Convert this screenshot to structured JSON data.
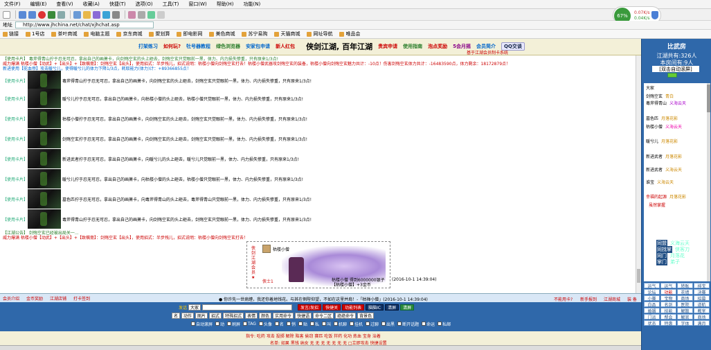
{
  "browser": {
    "menu": [
      "文件(F)",
      "编辑(E)",
      "查看(V)",
      "收藏(A)",
      "快捷(T)",
      "选项(O)",
      "工具(T)",
      "窗口(W)",
      "帮助(H)",
      "功能(N)"
    ],
    "address_label": "地址",
    "address_url": "http://www.jhchina.net/chat/xjhchat.asp",
    "bookmarks": [
      "链接",
      "1号店",
      "茶叶商城",
      "电脑主题",
      "京东商城",
      "聚划算",
      "即电影网",
      "美色商城",
      "苏宁易购",
      "天猫商城",
      "网址导航",
      "唯品会"
    ],
    "net_percent": "67%",
    "net_up": "0.07K/s",
    "net_down": "0.04K/s"
  },
  "topbar": {
    "links": [
      "打架练习",
      "如何玩?",
      "牡号器教程",
      "绿色浏览器",
      "安家包申请",
      "新人红包"
    ],
    "site_title": "侠剑江湖, 百年江湖",
    "links_right": [
      "贵宾申请",
      "使用指南",
      "泡点奖励",
      "5会月摇",
      "会员简介"
    ],
    "qq_label": "QQ交谈",
    "subtitle": "基于江湖会员制卡系统"
  },
  "chat": {
    "header_lines": [
      "【使用卡片】 毒斧得青山拧于忍无可忍，拿出自己的画萧卡，向剑殇空玄的头上砸去，剑殇空玄只觉眼前一黑，体力、内力损失惨重，只有原来1/3点!",
      "威力爆满 枯楼小僧【动武】+【出头】+【致嘱斋】：剑殇空玄【出头】，使用招式：半步残儿，招式说明：枯楼小僧向剑殇空玄打去！枯楼小僧武器攻剑殇空玄的装备，枯楼小僧向剑殇空玄魅力共计：-10点！伤害剑殇空玄体力共计：-16483590点，体力剩余：18172879点！",
      "新进使用【驼血帝】攻击暖兮儿，使得暖兮儿的体力下降1/3点，耗取能力(体力)计：+89366855点！"
    ],
    "entries": [
      {
        "tag": "【使用卡片】",
        "msg": "毒斧得青山拧于忍无可忍，拿出自己的画萧卡，向剑殇空玄的头上砸去，剑殇空玄只觉眼前一黑，体力、内力损失惨重，只有原来1/3点!"
      },
      {
        "tag": "【使用卡片】",
        "msg": "暖兮儿拧于忍无可忍，拿出自己的画萧卡，向枯楼小僧的头上砸去，枯楼小僧只觉眼前一黑，体力、内力损失惨重，只有原来1/3点!"
      },
      {
        "tag": "【使用卡片】",
        "msg": "枯楼小僧拧于忍无可忍，拿出自己的画萧卡，向剑殇空玄的头上砸去，剑殇空玄只觉眼前一黑，体力、内力损失惨重，只有原来1/3点!"
      },
      {
        "tag": "【使用卡片】",
        "msg": "剑殇空玄拧于忍无可忍，拿出自己的画萧卡，向剑殇空玄的头上砸去，剑殇空玄只觉眼前一黑，体力、内力损失惨重，只有原来1/3点!"
      },
      {
        "tag": "【使用卡片】",
        "msg": "新进武者拧于忍无可忍，拿出自己的画萧卡，向暖兮儿的头上砸去，暖兮儿只觉眼前一黑，体力、内力损失惨重，只有原来1/3点!"
      },
      {
        "tag": "【使用卡片】",
        "msg": "暖兮儿拧于忍无可忍，拿出自己的画萧卡，向枯楼小僧的头上砸去，枯楼小僧只觉眼前一黑，体力、内力损失惨重，只有原来1/3点!"
      },
      {
        "tag": "【使用卡片】",
        "msg": "墓色匹拧于忍无可忍，拿出自己的画萧卡，向毒斧得青山的头上砸去，毒斧得青山只觉眼前一黑，体力、内力损失惨重，只有原来1/3点!"
      },
      {
        "tag": "【使用卡片】",
        "msg": "毒斧得青山拧于忍无可忍，拿出自己的画萧卡，向剑殇空玄的头上砸去，剑殇空玄只觉眼前一黑，体力、内力损失惨重，只有原来1/3点!"
      }
    ],
    "footer_lines": [
      "【江湖公告】 剑殇空玄已经被出局关一...",
      "威力爆满 枯楼小僧【动武】+【出头】+【致嘱斋】：剑殇空玄【出头】，使用招式：半步残儿，招式说明：枯楼小僧向剑殇空玄打去！"
    ],
    "battle": {
      "vertical": "侠剑江湖会员★",
      "name": "枯楼小僧",
      "result1": "枯楼小僧 得到6000000银子",
      "result2": "【枯楼小僧】+3金币",
      "gear": "侠士1",
      "date": "(2016-10-1 14:39:04)"
    }
  },
  "sidebar": {
    "title": "比武房",
    "total": "江湖共有:326人",
    "room": "本房间有:9人",
    "select": "[双击自动滚屏]",
    "everyone": "大家",
    "users": [
      {
        "name": "剑殇空玄",
        "title": "青白"
      },
      {
        "name": "毒斧得青山",
        "title": "义海云天"
      },
      {
        "name": "墓色匹",
        "title": "月落花影"
      },
      {
        "name": "枯楼小僧",
        "title": "义海云天"
      },
      {
        "name": "暖兮儿",
        "title": "月落花影"
      },
      {
        "name": "新进武者",
        "title": "月落花影"
      },
      {
        "name": "新进武者",
        "title": "义海云天"
      },
      {
        "name": "谁宝",
        "title": "义海云天"
      },
      {
        "name": "幸福的起源",
        "title": "月落花影"
      },
      {
        "name": "",
        "title": "虽然掌握"
      }
    ],
    "roles": [
      {
        "label": "同盟",
        "value": "义海云天"
      },
      {
        "label": "同找掌",
        "value": "侠客刀"
      },
      {
        "label": "同门",
        "value": "月落花"
      },
      {
        "label": "掌门",
        "value": "弟子"
      }
    ],
    "grid": [
      "运气",
      "运气",
      "转账",
      "排宝",
      "论坛",
      "功能",
      "花墙",
      "决赛",
      "小赛",
      "宝物",
      "商场",
      "招募",
      "白品",
      "名剑",
      "医院",
      "道航",
      "婚姻",
      "技能",
      "解散",
      "教室",
      "门派",
      "帮会",
      "解官",
      "商场",
      "状态",
      "特惠",
      "字体",
      "满月"
    ]
  },
  "bottom": {
    "links": [
      "会员介绍",
      "金币奖励",
      "江湖店铺",
      "打卡签到"
    ],
    "notice": "● 你许先一世病缠，我还你着地钱花。与其在侧陛仰望，不如在这里并肩！-「枯禅小僧」(2016-10-1 14:39:04)",
    "right_links": [
      "不能用卡?",
      "新手报到",
      "江湖商城",
      "装 备"
    ],
    "controls": {
      "speaker_label": "发话",
      "target": "大家",
      "btn_speak": "发言/发招",
      "btn_clear": "快捷关",
      "btn_func": "功能列表",
      "btn_info": "脑脑IC",
      "btn_check": "清屏",
      "btn_green": "清屏",
      "sel1": "名",
      "sel2": "动作",
      "sel3": "图片",
      "sel4": "招式",
      "sel5": "特殊招式",
      "sel6": "表情",
      "sel7": "颜色",
      "sel8": "实用命令",
      "sel9": "快捷语",
      "sel10": "命令二区",
      "sel11": "绝绝命令",
      "sel12": "背景色",
      "checks": [
        "自动滚屏",
        "动",
        "刷屏",
        "TAG",
        "头像",
        "名",
        "悄",
        "贴",
        "私",
        "叫",
        "机聊",
        "挂机",
        "过聊",
        "出黑",
        "断开话题",
        "命运",
        "私邮"
      ]
    }
  },
  "footer": {
    "line1": "指令: 吃药  攻击  投掷  解除  陷害  偷窃  赛匹  吃饭  拌药  化功  炼血  宝身  治着",
    "line2": "名单: 如果  黑钱  纳女  无  无  无  无  无  无  无  □立即攻击  快捷设置"
  }
}
